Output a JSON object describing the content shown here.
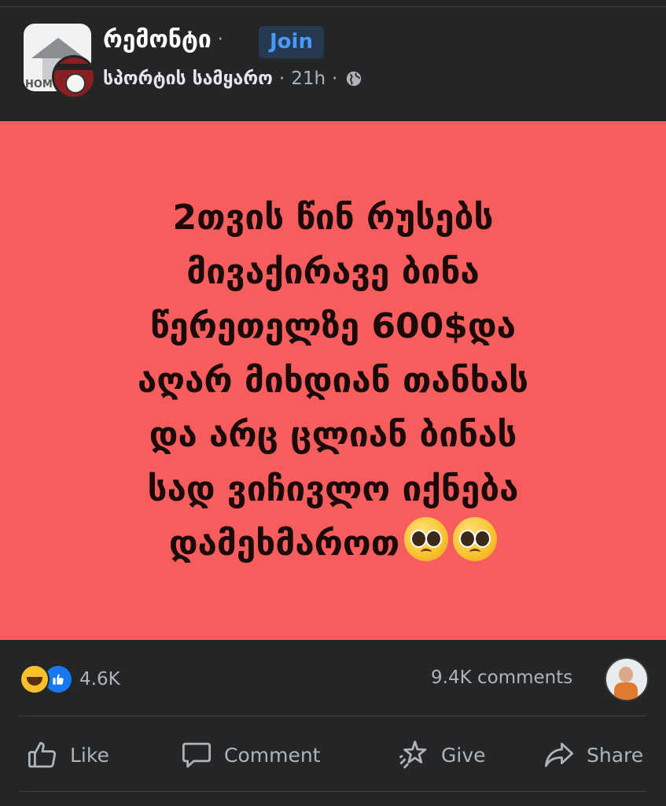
{
  "post": {
    "group_name": "რემონტი",
    "dot": "·",
    "join_label": "Join",
    "author": "სპორტის სამყარო",
    "time": "21h",
    "avatar_text": "HOM",
    "text_lines": [
      "2თვის წინ რუსებს",
      "მივაქირავე ბინა",
      "წერეთელზე  600$და",
      "აღარ მიხდიან თანხას",
      "და არც  ცლიან ბინას",
      "სად ვიჩივლო იქნება",
      "დამეხმაროთ"
    ],
    "background_color": "#f85d5d",
    "emoji": [
      "pleading-face-emoji",
      "pleading-face-emoji"
    ]
  },
  "stats": {
    "reaction_icons": [
      "haha-icon",
      "like-icon"
    ],
    "reaction_count": "4.6K",
    "comments": "9.4K comments"
  },
  "actions": {
    "like": "Like",
    "comment": "Comment",
    "give": "Give",
    "share": "Share"
  }
}
